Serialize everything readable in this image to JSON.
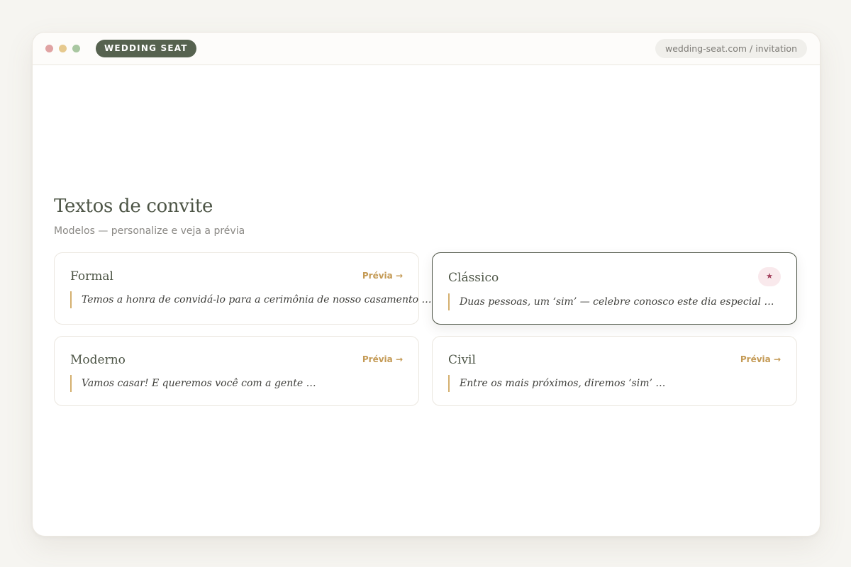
{
  "app": {
    "brand": "WEDDING SEAT",
    "url": "wedding-seat.com / invitation"
  },
  "page": {
    "title": "Textos de convite",
    "subtitle": "Modelos — personalize e veja a prévia"
  },
  "templates": [
    {
      "name": "Formal",
      "preview_label": "Prévia →",
      "text": "Temos a honra de convidá-lo para a cerimônia de nosso casamento …",
      "selected": false
    },
    {
      "name": "Clássico",
      "badge_icon": "star-icon",
      "badge_glyph": "★",
      "text": "Duas pessoas, um ‘sim’ — celebre conosco este dia especial …",
      "selected": true
    },
    {
      "name": "Moderno",
      "preview_label": "Prévia →",
      "text": "Vamos casar! E queremos você com a gente …",
      "selected": false
    },
    {
      "name": "Civil",
      "preview_label": "Prévia →",
      "text": "Entre os mais próximos, diremos ‘sim’ …",
      "selected": false
    }
  ],
  "colors": {
    "brand": "#56624f",
    "accent": "#c49a55",
    "badge": "#a2405c",
    "title": "#4d5546"
  }
}
